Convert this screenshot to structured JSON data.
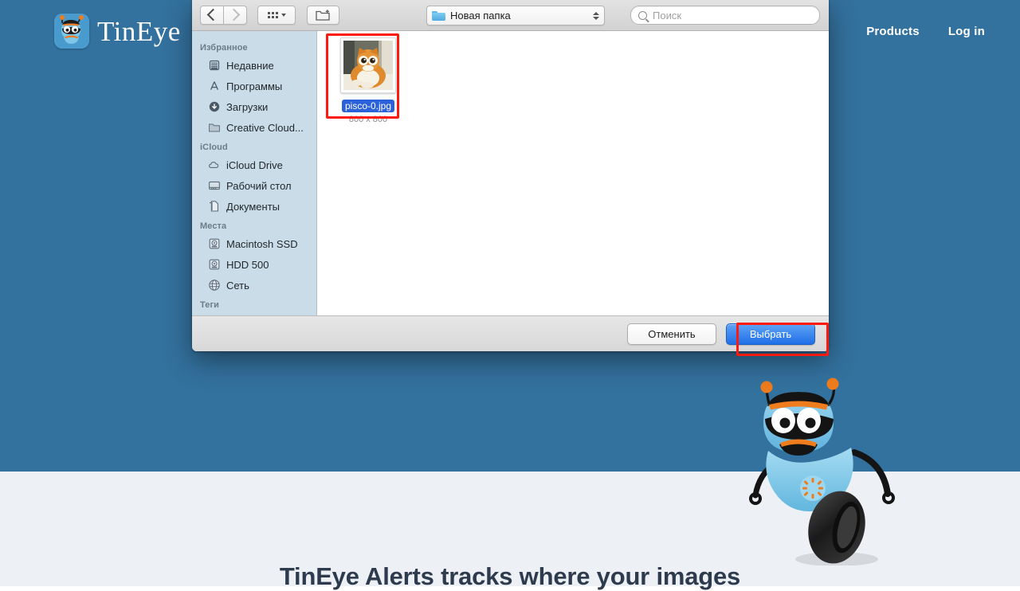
{
  "page": {
    "brand_name": "TinEye",
    "brand_icon": "tineye-robot-logo-icon",
    "nav": [
      {
        "label": "Products"
      },
      {
        "label": "Log in"
      }
    ],
    "headline": "TinEye Alerts tracks where your images",
    "mascot_icon": "tineye-robot-mascot",
    "colors": {
      "hero_background": "#33719e",
      "lower_background": "#edf1f5",
      "headline_text": "#2e3b4e"
    }
  },
  "dialog": {
    "toolbar": {
      "back_icon": "chevron-left-icon",
      "forward_icon": "chevron-right-icon",
      "view_mode_icon": "grid-view-icon",
      "view_mode_caret_icon": "chevron-down-icon",
      "new_folder_icon": "new-folder-icon",
      "path_popup": {
        "label": "Новая папка",
        "folder_icon": "folder-icon",
        "stepper_icon": "up-down-chevron-icon"
      },
      "search": {
        "placeholder": "Поиск",
        "value": "",
        "icon": "search-icon"
      }
    },
    "sidebar": {
      "sections": [
        {
          "title": "Избранное",
          "items": [
            {
              "label": "Недавние",
              "icon": "recents-clock-icon"
            },
            {
              "label": "Программы",
              "icon": "applications-icon"
            },
            {
              "label": "Загрузки",
              "icon": "downloads-icon"
            },
            {
              "label": "Creative Cloud...",
              "icon": "folder-icon"
            }
          ]
        },
        {
          "title": "iCloud",
          "items": [
            {
              "label": "iCloud Drive",
              "icon": "cloud-icon"
            },
            {
              "label": "Рабочий стол",
              "icon": "desktop-icon"
            },
            {
              "label": "Документы",
              "icon": "documents-icon"
            }
          ]
        },
        {
          "title": "Места",
          "items": [
            {
              "label": "Macintosh SSD",
              "icon": "hard-drive-icon"
            },
            {
              "label": "HDD 500",
              "icon": "hard-drive-icon"
            },
            {
              "label": "Сеть",
              "icon": "network-globe-icon"
            }
          ]
        },
        {
          "title": "Теги",
          "items": []
        }
      ]
    },
    "content": {
      "files": [
        {
          "name": "pisco-0.jpg",
          "dimensions": "800 x 800",
          "selected": true,
          "thumbnail_icon": "cat-photo-thumbnail"
        }
      ]
    },
    "footer": {
      "cancel_label": "Отменить",
      "choose_label": "Выбрать",
      "default_button": "Выбрать"
    },
    "annotations": {
      "file_highlight_color": "#fe1a0f",
      "choose_highlight_color": "#fe1a0f"
    }
  }
}
